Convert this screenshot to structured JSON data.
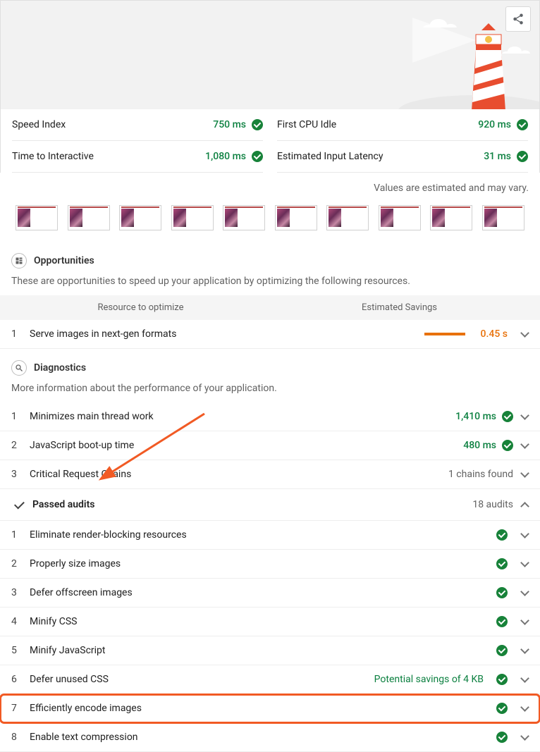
{
  "metrics": {
    "left": [
      {
        "label": "Speed Index",
        "value": "750 ms"
      },
      {
        "label": "Time to Interactive",
        "value": "1,080 ms"
      }
    ],
    "right": [
      {
        "label": "First CPU Idle",
        "value": "920 ms"
      },
      {
        "label": "Estimated Input Latency",
        "value": "31 ms"
      }
    ]
  },
  "estimate_note": "Values are estimated and may vary.",
  "opportunities": {
    "title": "Opportunities",
    "desc": "These are opportunities to speed up your application by optimizing the following resources.",
    "head_left": "Resource to optimize",
    "head_right": "Estimated Savings",
    "items": [
      {
        "num": "1",
        "title": "Serve images in next-gen formats",
        "value": "0.45 s",
        "bar_pct": 58
      }
    ]
  },
  "diagnostics": {
    "title": "Diagnostics",
    "desc": "More information about the performance of your application.",
    "items": [
      {
        "num": "1",
        "title": "Minimizes main thread work",
        "value": "1,410 ms",
        "pass": true
      },
      {
        "num": "2",
        "title": "JavaScript boot-up time",
        "value": "480 ms",
        "pass": true
      },
      {
        "num": "3",
        "title": "Critical Request Chains",
        "value": "1 chains found",
        "pass": false
      }
    ]
  },
  "passed": {
    "title": "Passed audits",
    "count": "18 audits",
    "items": [
      {
        "num": "1",
        "title": "Eliminate render-blocking resources"
      },
      {
        "num": "2",
        "title": "Properly size images"
      },
      {
        "num": "3",
        "title": "Defer offscreen images"
      },
      {
        "num": "4",
        "title": "Minify CSS"
      },
      {
        "num": "5",
        "title": "Minify JavaScript"
      },
      {
        "num": "6",
        "title": "Defer unused CSS",
        "extra": "Potential savings of 4 KB"
      },
      {
        "num": "7",
        "title": "Efficiently encode images",
        "highlight": true
      },
      {
        "num": "8",
        "title": "Enable text compression"
      }
    ]
  }
}
